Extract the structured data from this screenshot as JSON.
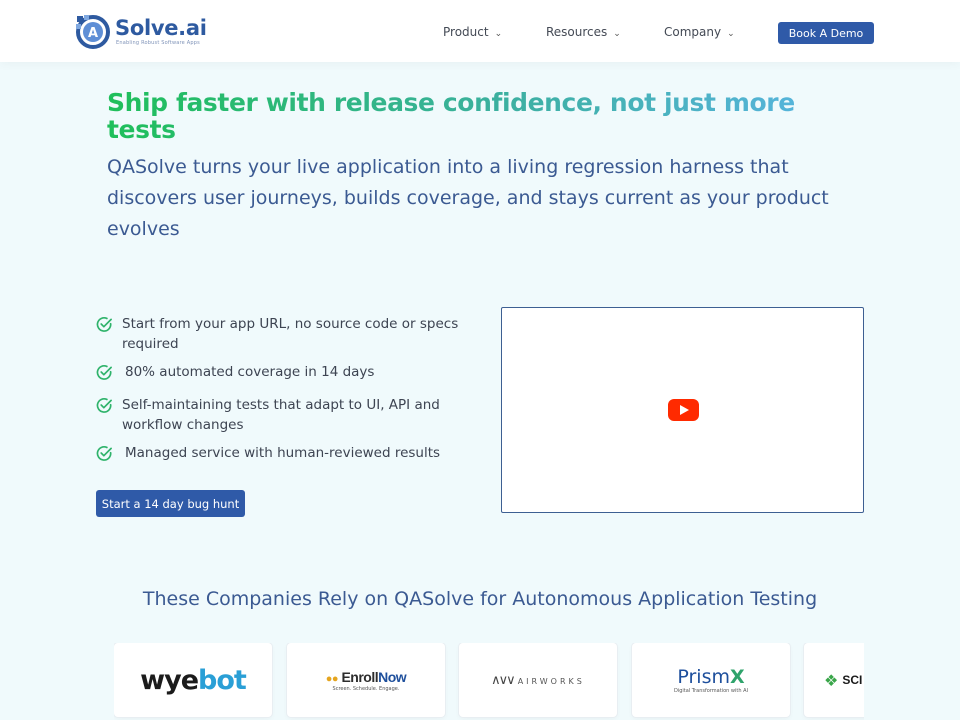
{
  "header": {
    "logo": {
      "name": "Solve.ai",
      "mark_letter": "A",
      "tagline": "Enabling Robust Software Apps"
    },
    "nav": [
      {
        "label": "Product"
      },
      {
        "label": "Resources"
      },
      {
        "label": "Company"
      }
    ],
    "demo_label": "Book A Demo"
  },
  "hero": {
    "title": "Ship faster with release confidence, not just more tests",
    "subtitle": "QASolve turns your live application into a living regression harness that discovers user journeys, builds coverage, and stays current as your product evolves",
    "features": [
      "Start from your app URL, no source code or specs required",
      "80% automated coverage in 14 days",
      "Self-maintaining tests that adapt to UI, API and workflow changes",
      "Managed service with human-reviewed results"
    ],
    "cta_label": "Start a 14 day bug hunt",
    "video": {
      "icon": "youtube-play-icon",
      "color": "#ff0000"
    }
  },
  "clients": {
    "title": "These Companies Rely on QASolve for Autonomous Application Testing",
    "logos": [
      {
        "name": "wyebot",
        "part_a": "wye",
        "part_b": "bot"
      },
      {
        "name": "EnrollNow",
        "part_a": "Enroll",
        "part_b": "Now",
        "tagline": "Screen. Schedule. Engage."
      },
      {
        "name": "AIRWORKS",
        "text": "AIRWORKS"
      },
      {
        "name": "PrismX",
        "part_a": "Prism",
        "part_b": "X",
        "tagline": "Digital Transformation with AI"
      },
      {
        "name": "SCR",
        "text": "SCI"
      }
    ]
  },
  "colors": {
    "accent": "#2f5aa8",
    "check": "#2fb36b",
    "title_start": "#1fbf5a",
    "title_end": "#58b4e0"
  }
}
